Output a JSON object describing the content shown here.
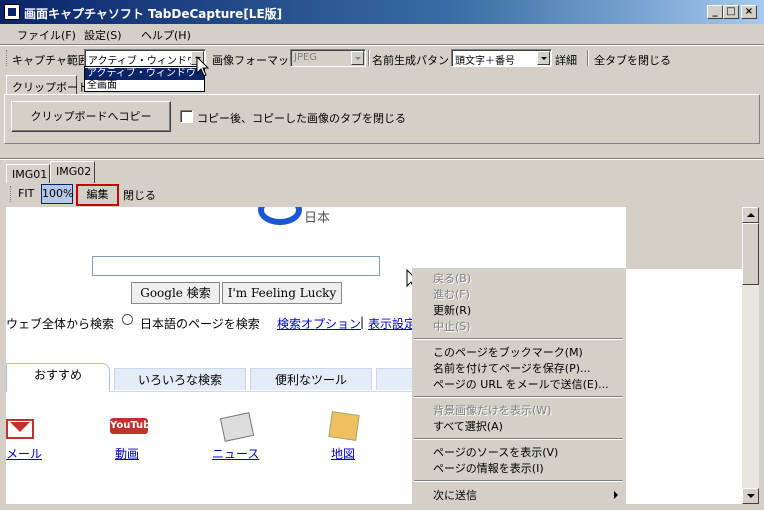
{
  "window": {
    "title": "画面キャプチャソフト TabDeCapture[LE版]",
    "controls": [
      "_",
      "□",
      "×"
    ]
  },
  "menu": [
    "ファイル(F)",
    "設定(S)",
    "ヘルプ(H)"
  ],
  "toolbar": {
    "capture_range_label": "キャプチャ範囲",
    "capture_range_value": "アクティブ・ウィンドウ",
    "capture_range_options": [
      "アクティブ・ウィンドウ",
      "全画面"
    ],
    "image_format_label": "画像フォーマット",
    "image_format_value": "JPEG",
    "name_pattern_label": "名前生成パタン",
    "name_pattern_value": "頭文字＋番号",
    "details_label": "詳細",
    "close_all_tabs_label": "全タブを閉じる"
  },
  "clipboard": {
    "tab_label": "クリップボード",
    "copy_button": "クリップボードへコピー",
    "close_after_copy_label": "コピー後、コピーした画像のタブを閉じる"
  },
  "image_tabs": [
    "IMG01",
    "IMG02"
  ],
  "image_toolbar": {
    "fit": "FIT",
    "zoom": "100%",
    "edit": "編集",
    "close": "閉じる"
  },
  "captured_page": {
    "logo_text": "日本",
    "search_button": "Google 検索",
    "lucky_button": "I'm Feeling Lucky",
    "radio_web": "ウェブ全体から検索",
    "radio_jp": "日本語のページを検索",
    "link_options": "検索オプション",
    "separator": "|",
    "link_settings": "表示設定",
    "tabs": [
      "おすすめ",
      "いろいろな検索",
      "便利なツール"
    ],
    "apps": [
      {
        "label": "メール"
      },
      {
        "label": "動画",
        "icon_text": "YouTube"
      },
      {
        "label": "ニュース"
      },
      {
        "label": "地図"
      }
    ]
  },
  "context_menu": [
    {
      "label": "戻る(B)",
      "disabled": true
    },
    {
      "label": "進む(F)",
      "disabled": true
    },
    {
      "label": "更新(R)",
      "disabled": false
    },
    {
      "label": "中止(S)",
      "disabled": true
    },
    {
      "label": "このページをブックマーク(M)",
      "disabled": false
    },
    {
      "label": "名前を付けてページを保存(P)...",
      "disabled": false
    },
    {
      "label": "ページの URL をメールで送信(E)...",
      "disabled": false
    },
    {
      "label": "背景画像だけを表示(W)",
      "disabled": true
    },
    {
      "label": "すべて選択(A)",
      "disabled": false
    },
    {
      "label": "ページのソースを表示(V)",
      "disabled": false
    },
    {
      "label": "ページの情報を表示(I)",
      "disabled": false
    },
    {
      "label": "次に送信",
      "disabled": false
    }
  ],
  "colors": {
    "title_bar": "#0a246a",
    "highlight": "#0a246a",
    "edit_outline": "#cc0000",
    "zoom_active": "#b6c8e8",
    "link": "#0000cc"
  }
}
